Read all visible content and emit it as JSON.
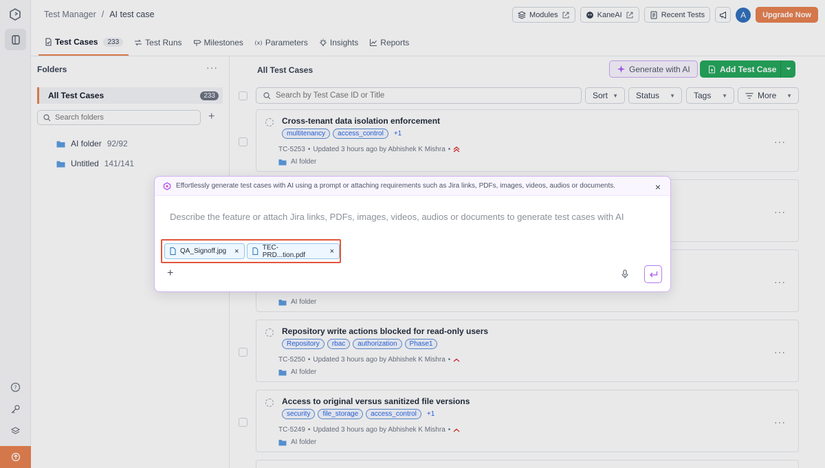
{
  "header": {
    "breadcrumb": [
      "Test Manager",
      "/",
      "AI test case"
    ],
    "buttons": {
      "modules": "Modules",
      "kaneai": "KaneAI",
      "recent_tests": "Recent Tests",
      "upgrade": "Upgrade Now"
    },
    "avatar_initial": "A"
  },
  "tabs": [
    {
      "label": "Test Cases",
      "count": "233"
    },
    {
      "label": "Test Runs"
    },
    {
      "label": "Milestones"
    },
    {
      "label": "Parameters"
    },
    {
      "label": "Insights"
    },
    {
      "label": "Reports"
    }
  ],
  "folders": {
    "title": "Folders",
    "more": "···",
    "all_label": "All Test Cases",
    "all_count": "233",
    "search_placeholder": "Search folders",
    "add": "+",
    "items": [
      {
        "name": "AI folder",
        "count": "92/92"
      },
      {
        "name": "Untitled",
        "count": "141/141"
      }
    ]
  },
  "main": {
    "heading": "All Test Cases",
    "generate_ai": "Generate with AI",
    "add_test_case": "Add Test Case",
    "search_placeholder": "Search by Test Case ID or Title",
    "filters": [
      "Sort",
      "Status",
      "Tags",
      "More"
    ]
  },
  "cards": [
    {
      "title": "Cross-tenant data isolation enforcement",
      "tags": [
        "multitenancy",
        "access_control"
      ],
      "extra": "+1",
      "id": "TC-5253",
      "updated": "Updated 3 hours ago by Abhishek K Mishra",
      "priority": "high",
      "folder": "AI folder"
    },
    {
      "title": "",
      "tags": [],
      "extra": "",
      "id": "",
      "updated": "",
      "priority": "",
      "folder": ""
    },
    {
      "title": "",
      "tags": [],
      "extra": "",
      "id": "",
      "updated": "",
      "priority": "",
      "folder": "AI folder"
    },
    {
      "title": "Repository write actions blocked for read-only users",
      "tags": [
        "Repository",
        "rbac",
        "authorization",
        "Phase1"
      ],
      "extra": "",
      "id": "TC-5250",
      "updated": "Updated 3 hours ago by Abhishek K Mishra",
      "priority": "medium",
      "folder": "AI folder"
    },
    {
      "title": "Access to original versus sanitized file versions",
      "tags": [
        "security",
        "file_storage",
        "access_control"
      ],
      "extra": "+1",
      "id": "TC-5249",
      "updated": "Updated 3 hours ago by Abhishek K Mishra",
      "priority": "medium",
      "folder": "AI folder"
    }
  ],
  "modal": {
    "banner": "Effortlessly generate test cases with AI using a prompt or attaching requirements such as Jira links, PDFs, images, videos, audios or documents.",
    "prompt_placeholder": "Describe the feature or attach Jira links, PDFs, images, videos, audios or documents to generate test cases with AI",
    "attachments": [
      {
        "name": "QA_Signoff.jpg"
      },
      {
        "name": "TEC- PRD...tion.pdf"
      }
    ],
    "add": "+",
    "close": "×",
    "remove": "×"
  },
  "colors": {
    "accent": "#e8804d",
    "primary_green": "#22a65a",
    "ai_purple": "#b57af0",
    "highlight_red": "#e2553d",
    "link_blue": "#2563eb"
  }
}
